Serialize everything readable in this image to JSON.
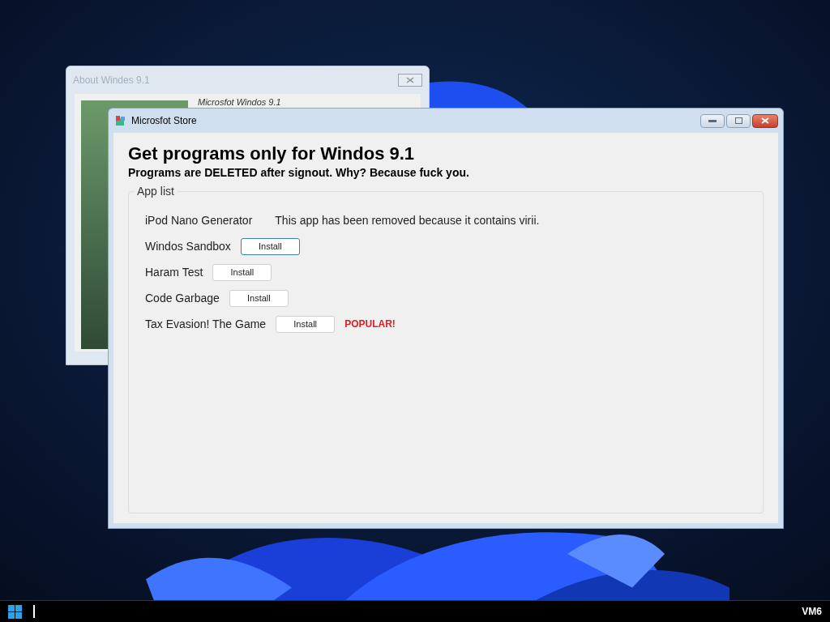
{
  "back_window": {
    "title": "About Windes 9.1",
    "product": "Microsfot Windos 9.1"
  },
  "window": {
    "title": "Microsfot Store",
    "heading": "Get programs only for Windos 9.1",
    "subheading": "Programs are DELETED after signout. Why? Because fuck you.",
    "group": {
      "label": "App list",
      "apps": [
        {
          "kind": "removed",
          "name": "iPod Nano Generator",
          "message": "This app has been removed because it contains virii."
        },
        {
          "kind": "install",
          "name": "Windos Sandbox",
          "button": "Install",
          "focused": true
        },
        {
          "kind": "install",
          "name": "Haram Test",
          "button": "Install",
          "focused": false
        },
        {
          "kind": "install",
          "name": "Code Garbage",
          "button": "Install",
          "focused": false
        },
        {
          "kind": "install",
          "name": "Tax Evasion! The Game",
          "button": "Install",
          "focused": false,
          "badge": "POPULAR!"
        }
      ]
    }
  },
  "taskbar": {
    "label": "VM6"
  }
}
